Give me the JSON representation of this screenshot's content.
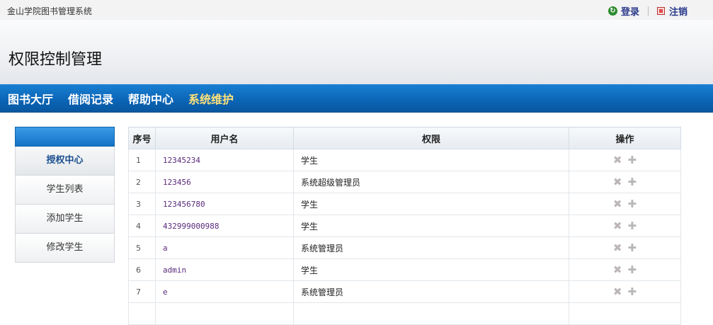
{
  "top": {
    "site_name": "金山学院图书管理系统",
    "login_label": "登录",
    "logout_label": "注销"
  },
  "header": {
    "title": "权限控制管理"
  },
  "nav": {
    "items": [
      {
        "label": "图书大厅",
        "active": false
      },
      {
        "label": "借阅记录",
        "active": false
      },
      {
        "label": "帮助中心",
        "active": false
      },
      {
        "label": "系统维护",
        "active": true
      }
    ]
  },
  "sidebar": {
    "items": [
      {
        "label": "授权中心",
        "active": true
      },
      {
        "label": "学生列表",
        "active": false
      },
      {
        "label": "添加学生",
        "active": false
      },
      {
        "label": "修改学生",
        "active": false
      }
    ]
  },
  "table": {
    "headers": [
      "序号",
      "用户名",
      "权限",
      "操作"
    ],
    "rows": [
      {
        "no": "1",
        "username": "12345234",
        "permission": "学生"
      },
      {
        "no": "2",
        "username": "123456",
        "permission": "系统超级管理员"
      },
      {
        "no": "3",
        "username": "123456780",
        "permission": "学生"
      },
      {
        "no": "4",
        "username": "432999000988",
        "permission": "学生"
      },
      {
        "no": "5",
        "username": "a",
        "permission": "系统管理员"
      },
      {
        "no": "6",
        "username": "admin",
        "permission": "学生"
      },
      {
        "no": "7",
        "username": "e",
        "permission": "系统管理员"
      },
      {
        "no": "",
        "username": "",
        "permission": ""
      }
    ],
    "delete_icon": "delete-x-icon",
    "add_icon": "add-plus-icon"
  }
}
